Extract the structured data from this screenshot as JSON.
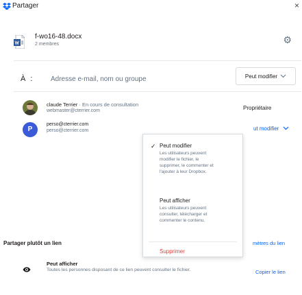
{
  "window": {
    "title": "Partager",
    "close_glyph": "×"
  },
  "file": {
    "name": "f-wo16-48.docx",
    "members": "2 membres",
    "icon": "word-file-icon"
  },
  "invite": {
    "label": "À :",
    "placeholder": "Adresse e-mail, nom ou groupe",
    "permission": "Peut modifier"
  },
  "members": [
    {
      "name": "claude Terrier",
      "status": "· En cours de consultation",
      "email": "webmaster@cterrier.com",
      "role": "Propriétaire"
    },
    {
      "name": "perso@cterrier.com",
      "email": "perso@cterrier.com",
      "role": "ut modifier",
      "avatar_letter": "P"
    }
  ],
  "dropdown": {
    "options": [
      {
        "title": "Peut modifier",
        "checked": true,
        "desc": [
          "Les utilisateurs peuvent",
          "modifier le fichier, le",
          "supprimer, le commenter et",
          "l'ajouter à leur Dropbox."
        ]
      },
      {
        "title": "Peut afficher",
        "checked": false,
        "desc": [
          "Les utilisateurs peuvent",
          "consulter, télécharger et",
          "commenter le contenu."
        ]
      }
    ],
    "remove": "Supprimer"
  },
  "link": {
    "header": "Partager plutôt un lien",
    "params": "mètres du lien",
    "view_title": "Peut afficher",
    "view_desc": "Toutes les personnes disposant de ce lien peuvent consulter le fichier.",
    "copy": "Copier le lien"
  },
  "colors": {
    "accent": "#0061fe",
    "danger": "#d93f3c",
    "muted": "#637282",
    "avatar": "#3b5bd9"
  }
}
